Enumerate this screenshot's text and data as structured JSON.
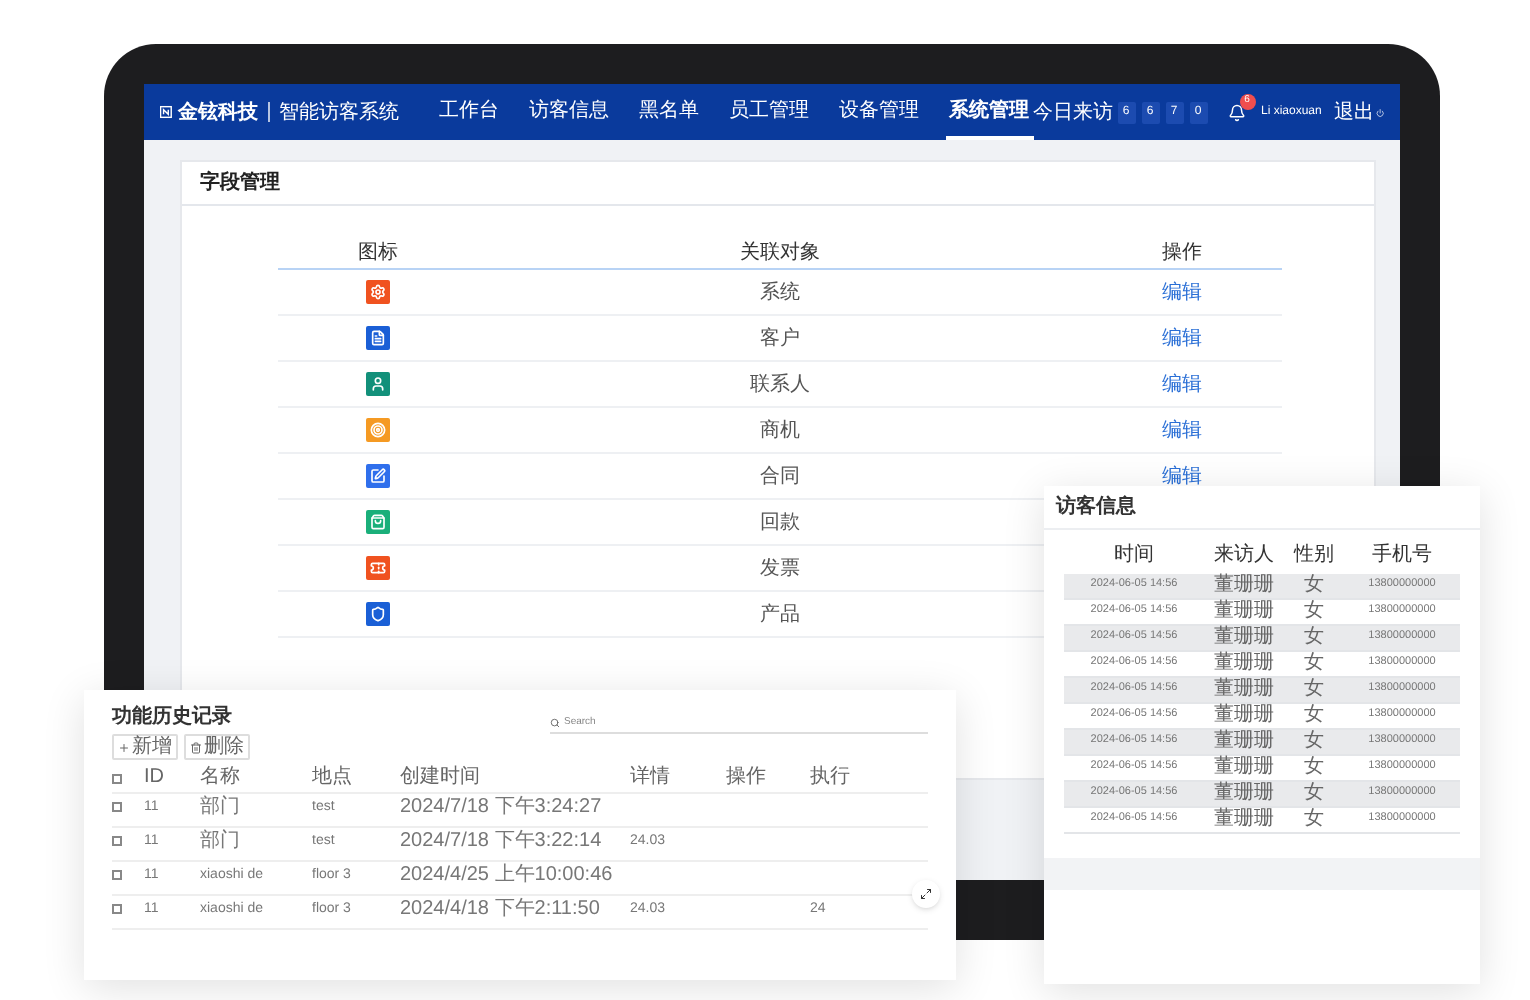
{
  "nav": {
    "brand": "金铉科技",
    "product": "智能访客系统",
    "menu": [
      {
        "label": "工作台",
        "selected": false
      },
      {
        "label": "访客信息",
        "selected": false
      },
      {
        "label": "黑名单",
        "selected": false
      },
      {
        "label": "员工管理",
        "selected": false
      },
      {
        "label": "设备管理",
        "selected": false
      },
      {
        "label": "系统管理",
        "selected": true
      }
    ],
    "visits_label": "今日来访",
    "visit_digits": [
      "6",
      "6",
      "7",
      "0"
    ],
    "notification_count": "6",
    "user": "Li xiaoxuan",
    "logout": "退出"
  },
  "field_panel": {
    "title": "字段管理",
    "columns": [
      "图标",
      "关联对象",
      "操作"
    ],
    "rows": [
      {
        "kind": "gear",
        "color": "#f0521f",
        "object": "系统",
        "action": "编辑"
      },
      {
        "kind": "document",
        "color": "#1a5fd6",
        "object": "客户",
        "action": "编辑"
      },
      {
        "kind": "person",
        "color": "#12907a",
        "object": "联系人",
        "action": "编辑"
      },
      {
        "kind": "target",
        "color": "#f59a23",
        "object": "商机",
        "action": "编辑"
      },
      {
        "kind": "edit",
        "color": "#2f6fec",
        "object": "合同",
        "action": "编辑"
      },
      {
        "kind": "bag",
        "color": "#1aaf7a",
        "object": "回款"
      },
      {
        "kind": "ticket",
        "color": "#f0521f",
        "object": "发票"
      },
      {
        "kind": "shield",
        "color": "#1a5fd6",
        "object": "产品"
      }
    ]
  },
  "visitor_card": {
    "title": "访客信息",
    "columns": [
      "时间",
      "来访人",
      "性别",
      "手机号"
    ],
    "rows": [
      {
        "time": "2024-06-05  14:56",
        "visitor": "董珊珊",
        "gender": "女",
        "phone": "13800000000"
      },
      {
        "time": "2024-06-05  14:56",
        "visitor": "董珊珊",
        "gender": "女",
        "phone": "13800000000"
      },
      {
        "time": "2024-06-05  14:56",
        "visitor": "董珊珊",
        "gender": "女",
        "phone": "13800000000"
      },
      {
        "time": "2024-06-05  14:56",
        "visitor": "董珊珊",
        "gender": "女",
        "phone": "13800000000"
      },
      {
        "time": "2024-06-05  14:56",
        "visitor": "董珊珊",
        "gender": "女",
        "phone": "13800000000"
      },
      {
        "time": "2024-06-05  14:56",
        "visitor": "董珊珊",
        "gender": "女",
        "phone": "13800000000"
      },
      {
        "time": "2024-06-05  14:56",
        "visitor": "董珊珊",
        "gender": "女",
        "phone": "13800000000"
      },
      {
        "time": "2024-06-05  14:56",
        "visitor": "董珊珊",
        "gender": "女",
        "phone": "13800000000"
      },
      {
        "time": "2024-06-05  14:56",
        "visitor": "董珊珊",
        "gender": "女",
        "phone": "13800000000"
      },
      {
        "time": "2024-06-05  14:56",
        "visitor": "董珊珊",
        "gender": "女",
        "phone": "13800000000"
      }
    ]
  },
  "history_card": {
    "title": "功能历史记录",
    "buttons": [
      "新增",
      "删除"
    ],
    "all_checked": false,
    "search": {
      "placeholder": "Search"
    },
    "columns": [
      "ID",
      "名称",
      "地点",
      "创建时间",
      "详情",
      "操作",
      "执行"
    ],
    "rows": [
      {
        "checked": false,
        "cells": [
          "11",
          "部门",
          "test",
          "2024/7/18 下午3:24:27",
          "",
          "",
          ""
        ]
      },
      {
        "checked": false,
        "cells": [
          "11",
          "部门",
          "test",
          "2024/7/18 下午3:22:14",
          "24.03",
          "",
          ""
        ]
      },
      {
        "checked": false,
        "cells": [
          "11",
          "xiaoshi de",
          "floor 3",
          "2024/4/25 上午10:00:46",
          "",
          "",
          ""
        ]
      },
      {
        "checked": false,
        "cells": [
          "11",
          "xiaoshi de",
          "floor 3",
          "2024/4/18 下午2:11:50",
          "24.03",
          "",
          "24"
        ]
      }
    ]
  }
}
